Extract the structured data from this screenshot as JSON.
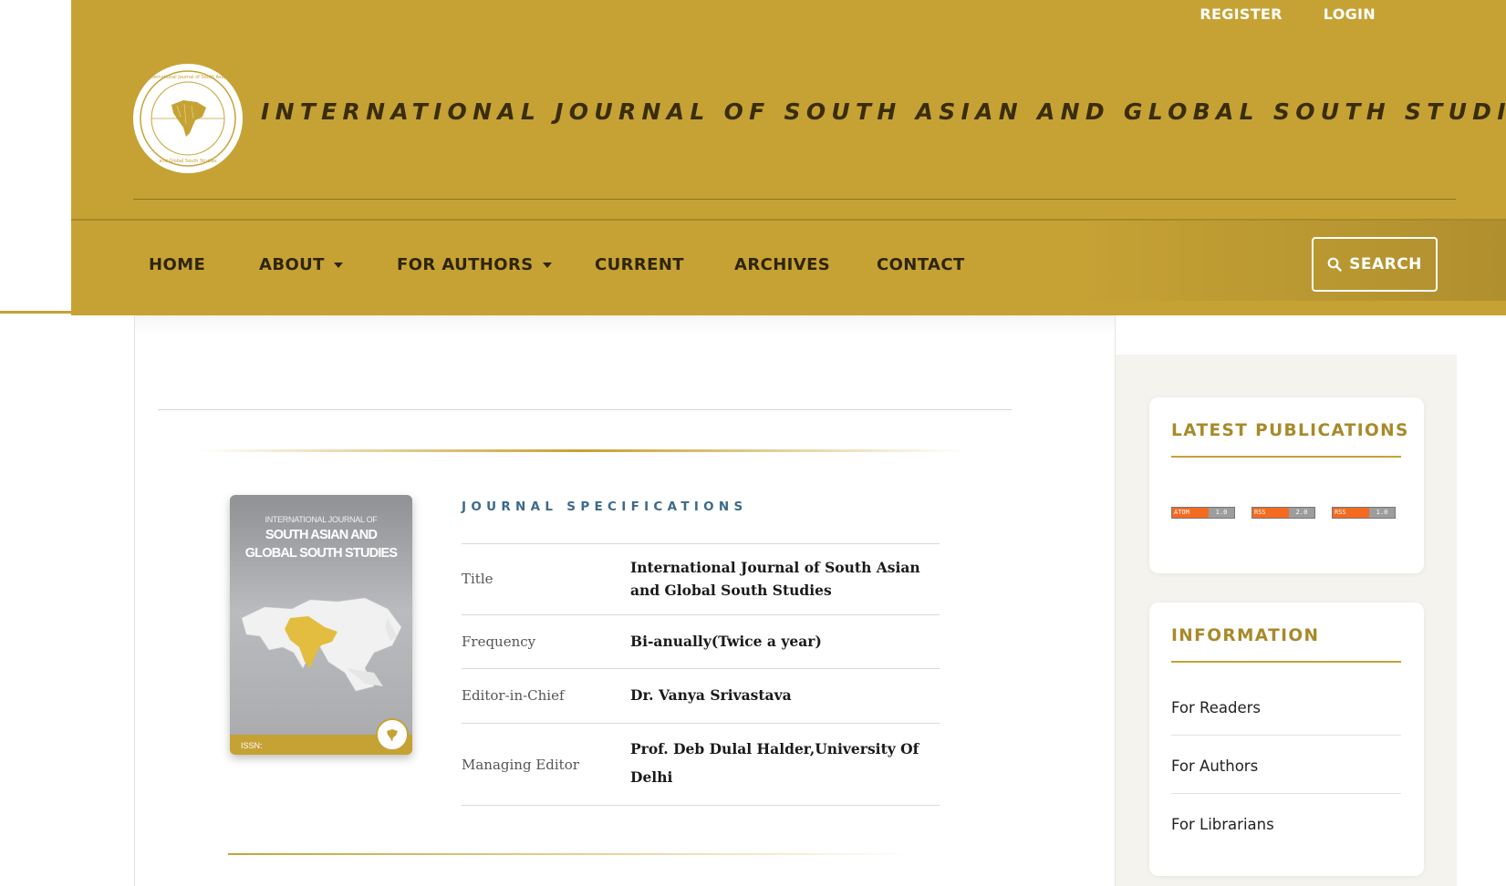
{
  "header": {
    "top_links": {
      "register": "REGISTER",
      "login": "LOGIN"
    },
    "title": "INTERNATIONAL JOURNAL OF SOUTH ASIAN AND GLOBAL SOUTH STUDIES",
    "logo_icon": "journal-seal-logo",
    "brand_color": "#c6a235"
  },
  "nav": {
    "items": [
      {
        "label": "HOME",
        "has_dropdown": false
      },
      {
        "label": "ABOUT",
        "has_dropdown": true
      },
      {
        "label": "FOR AUTHORS",
        "has_dropdown": true
      },
      {
        "label": "CURRENT",
        "has_dropdown": false
      },
      {
        "label": "ARCHIVES",
        "has_dropdown": false
      },
      {
        "label": "CONTACT",
        "has_dropdown": false
      }
    ],
    "search_label": "SEARCH"
  },
  "cover": {
    "line1": "INTERNATIONAL JOURNAL OF",
    "line2": "SOUTH ASIAN AND",
    "line3": "GLOBAL SOUTH STUDIES",
    "issn": "ISSN:"
  },
  "specs": {
    "heading": "JOURNAL SPECIFICATIONS",
    "rows": [
      {
        "label": "Title",
        "value": "International Journal of South Asian and Global South Studies"
      },
      {
        "label": "Frequency",
        "value": "Bi-anually(Twice a year)"
      },
      {
        "label": "Editor-in-Chief",
        "value": "Dr. Vanya Srivastava"
      },
      {
        "label": "Managing Editor",
        "value": "Prof. Deb Dulal Halder,University Of Delhi"
      }
    ]
  },
  "sidebar": {
    "latest": {
      "title": "LATEST PUBLICATIONS",
      "feeds": [
        {
          "type": "ATOM",
          "version": "1.0"
        },
        {
          "type": "RSS",
          "version": "2.0"
        },
        {
          "type": "RSS",
          "version": "1.0"
        }
      ]
    },
    "information": {
      "title": "INFORMATION",
      "links": [
        "For Readers",
        "For Authors",
        "For Librarians"
      ]
    }
  }
}
